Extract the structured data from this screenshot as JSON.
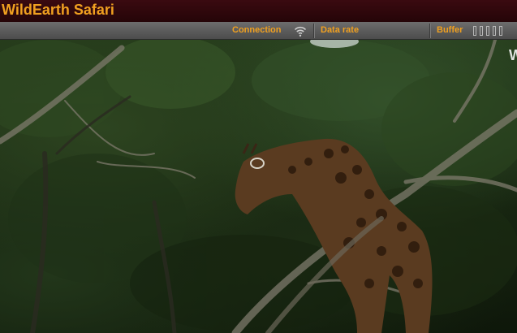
{
  "app": {
    "title": "WildEarth Safari"
  },
  "status": {
    "connection_label": "Connection",
    "connection_icon": "wifi-signal-icon",
    "datarate_label": "Data rate",
    "buffer_label": "Buffer",
    "buffer_segments": 5,
    "buffer_filled": 0
  },
  "video": {
    "watermark": "WILDEARTH.TV",
    "subject": "giraffe"
  },
  "colors": {
    "accent": "#f0a020",
    "titlebar": "#2e070b",
    "statusbar": "#5c5c5c"
  }
}
